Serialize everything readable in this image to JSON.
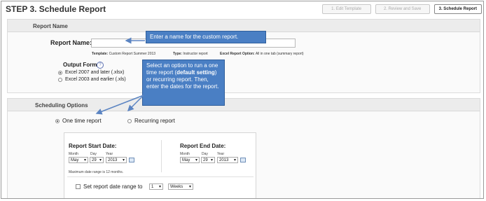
{
  "header": {
    "title": "STEP 3. Schedule Report",
    "steps": [
      "1. Edit Template",
      "2. Review and Save",
      "3. Schedule Report"
    ]
  },
  "report_name": {
    "section_title": "Report Name",
    "label": "Report Name:",
    "value": "",
    "template_label": "Template:",
    "template_value": "Custom Report Summer 2013",
    "type_label": "Type:",
    "type_value": "Instructor report",
    "excel_label": "Excel Report Option:",
    "excel_value": "All in one tab (summary report)",
    "output_format_label": "Output Format",
    "help_icon": "?",
    "formats": [
      {
        "label": "Excel 2007 and later (.xlsx)",
        "selected": true
      },
      {
        "label": "Excel 2003 and earlier (.xls)",
        "selected": false
      }
    ]
  },
  "callouts": {
    "name_callout": "Enter a name for the custom report.",
    "schedule_callout_pre": "Select an option to run a one time report (",
    "schedule_callout_bold": "default setting",
    "schedule_callout_post": ") or recurring report. Then, enter the dates for the report."
  },
  "scheduling": {
    "section_title": "Scheduling Options",
    "options": [
      {
        "label": "One time report",
        "selected": true
      },
      {
        "label": "Recurring report",
        "selected": false
      }
    ],
    "start": {
      "title": "Report Start Date:",
      "month_label": "Month",
      "day_label": "Day",
      "year_label": "Year",
      "month": "May",
      "day": "29",
      "year": "2013"
    },
    "end": {
      "title": "Report End Date:",
      "month_label": "Month",
      "day_label": "Day",
      "year_label": "Year",
      "month": "May",
      "day": "29",
      "year": "2013"
    },
    "max_range_note": "Maximum date range is 12 months.",
    "range_label": "Set report date range to",
    "range_value": "1",
    "range_unit": "Weeks"
  },
  "colors": {
    "callout_bg": "#4a7fc4",
    "arrow": "#5b84c2"
  }
}
